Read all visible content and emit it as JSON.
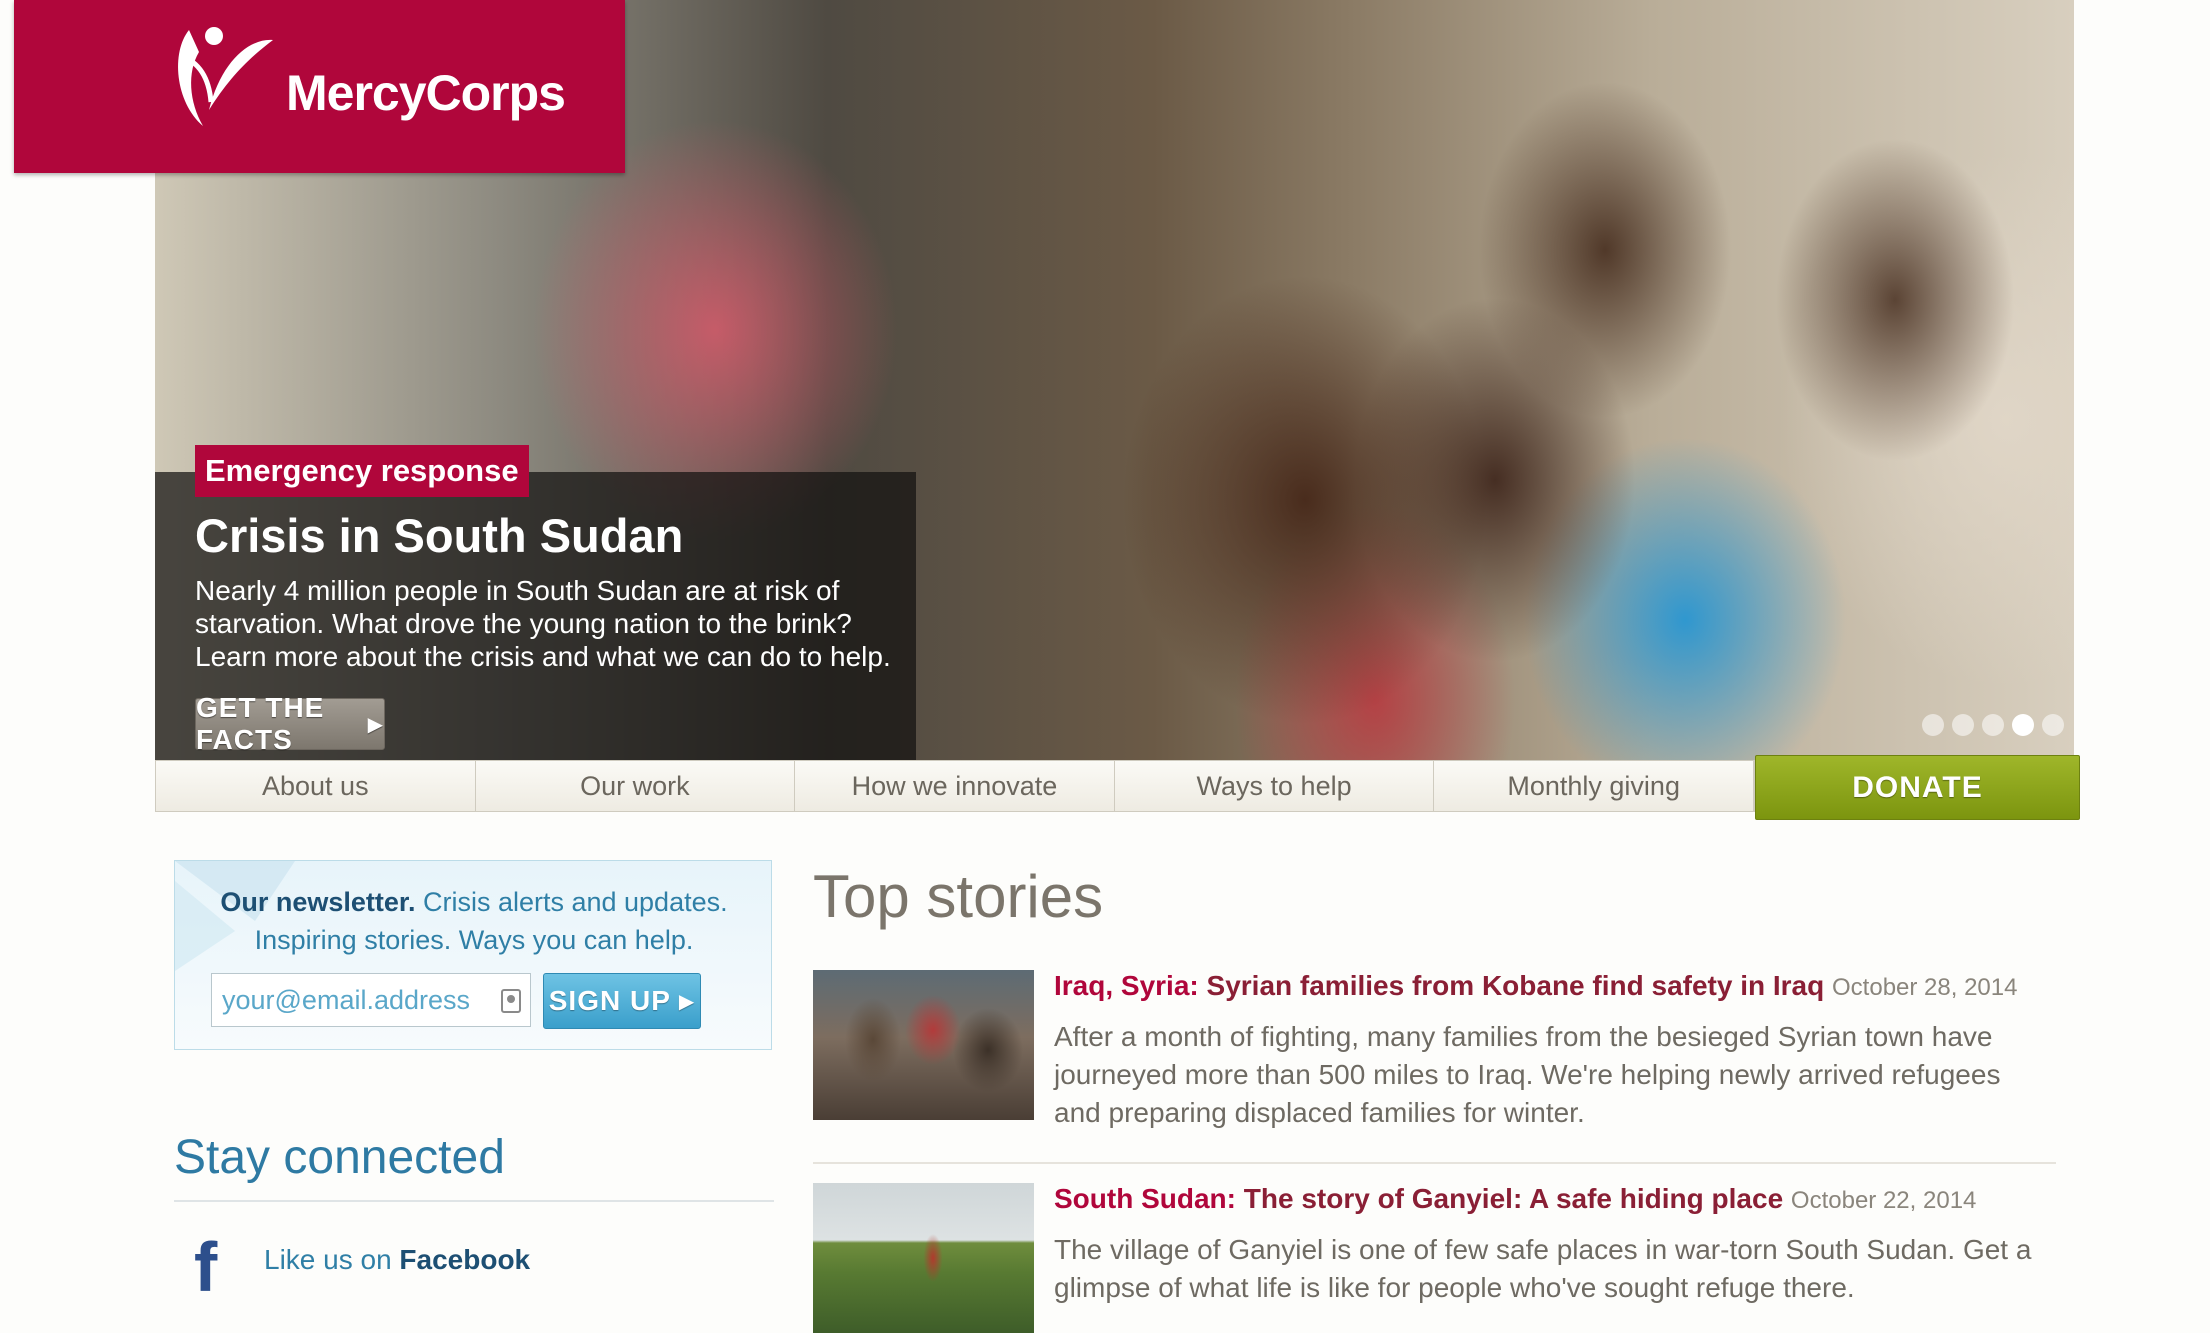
{
  "brand": {
    "name": "MercyCorps",
    "color": "#b0063b"
  },
  "hero": {
    "tag": "Emergency response",
    "title": "Crisis in South Sudan",
    "body": "Nearly 4 million people in South Sudan are at risk of starvation. What drove the young nation to the brink? Learn more about the crisis and what we can do to help.",
    "button_label": "GET THE FACTS",
    "slides": 5,
    "active_slide": 4
  },
  "nav": {
    "items": [
      {
        "label": "About us"
      },
      {
        "label": "Our work"
      },
      {
        "label": "How we innovate"
      },
      {
        "label": "Ways to help"
      },
      {
        "label": "Monthly giving"
      }
    ],
    "donate_label": "DONATE",
    "donate_color": "#8aa51c"
  },
  "newsletter": {
    "lead": "Our newsletter.",
    "text1": " Crisis alerts and updates.",
    "text2": "Inspiring stories. Ways you can help.",
    "placeholder": "your@email.address",
    "button_label": "SIGN UP"
  },
  "social": {
    "title": "Stay connected",
    "facebook_prefix": "Like us on ",
    "facebook_name": "Facebook"
  },
  "stories": {
    "title": "Top stories",
    "items": [
      {
        "region": "Iraq, Syria:",
        "headline": "Syrian families from Kobane find safety in Iraq",
        "date": "October 28, 2014",
        "body": "After a month of fighting, many families from the besieged Syrian town have journeyed more than 500 miles to Iraq. We're helping newly arrived refugees and preparing displaced families for winter."
      },
      {
        "region": "South Sudan:",
        "headline": "The story of Ganyiel: A safe hiding place",
        "date": "October 22, 2014",
        "body": "The village of Ganyiel is one of few safe places in war-torn South Sudan. Get a glimpse of what life is like for people who've sought refuge there."
      }
    ]
  }
}
